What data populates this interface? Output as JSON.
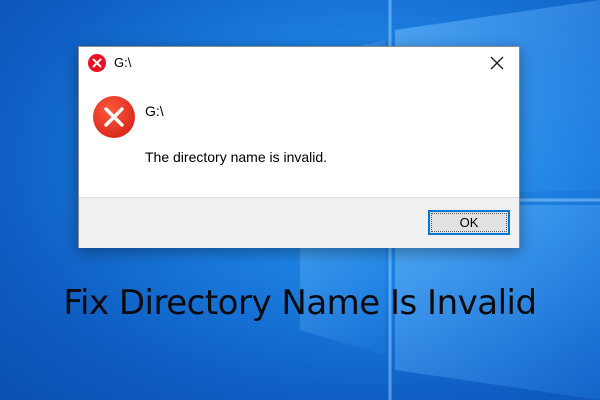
{
  "dialog": {
    "title": "G:\\",
    "drive": "G:\\",
    "message": "The directory name is invalid.",
    "ok_label": "OK"
  },
  "headline": "Fix Directory Name Is Invalid",
  "colors": {
    "error_red": "#e81123",
    "button_border": "#0078d7",
    "desktop_blue": "#1c7fe0"
  },
  "icons": [
    "error-icon",
    "close-icon",
    "windows-logo"
  ]
}
